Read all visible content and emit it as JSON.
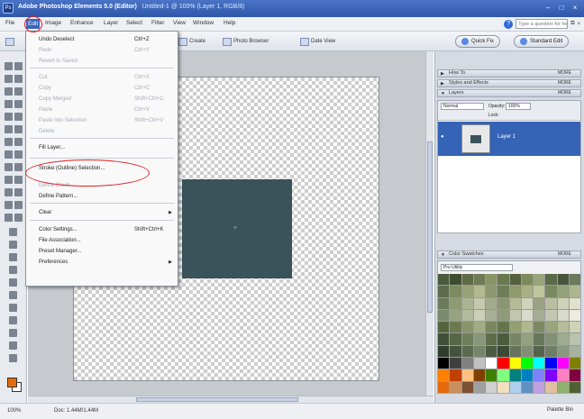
{
  "window": {
    "app_title": "Adobe Photoshop Elements 5.0 (Editor)",
    "doc_title": "Untitled-1 @ 100% (Layer 1, RGB/8)",
    "min": "–",
    "max": "□",
    "close": "×"
  },
  "menubar": {
    "items": [
      "File",
      "Edit",
      "Image",
      "Enhance",
      "Layer",
      "Select",
      "Filter",
      "View",
      "Window",
      "Help"
    ],
    "help_placeholder": "Type a question for help"
  },
  "shortcuts": {
    "create": "Create",
    "photo_browser": "Photo Browser",
    "date_view": "Date View",
    "quick_fix": "Quick Fix",
    "standard_edit": "Standard Edit"
  },
  "edit_menu": {
    "items": [
      {
        "label": "Undo Deselect",
        "shortcut": "Ctrl+Z",
        "enabled": true
      },
      {
        "label": "Redo",
        "shortcut": "Ctrl+Y",
        "enabled": false
      },
      {
        "label": "Revert to Saved",
        "shortcut": "",
        "enabled": false
      },
      {
        "label": "Cut",
        "shortcut": "Ctrl+X",
        "enabled": false
      },
      {
        "label": "Copy",
        "shortcut": "Ctrl+C",
        "enabled": false
      },
      {
        "label": "Copy Merged",
        "shortcut": "Shift+Ctrl+C",
        "enabled": false
      },
      {
        "label": "Paste",
        "shortcut": "Ctrl+V",
        "enabled": false
      },
      {
        "label": "Paste Into Selection",
        "shortcut": "Shift+Ctrl+V",
        "enabled": false
      },
      {
        "label": "Delete",
        "shortcut": "",
        "enabled": false
      },
      {
        "label": "Fill Layer...",
        "shortcut": "",
        "enabled": true
      },
      {
        "label": "Stroke (Outline) Selection...",
        "shortcut": "",
        "enabled": true
      },
      {
        "label": "Define Brush...",
        "shortcut": "",
        "enabled": false
      },
      {
        "label": "Define Pattern...",
        "shortcut": "",
        "enabled": true
      },
      {
        "label": "Clear",
        "shortcut": "",
        "enabled": true
      },
      {
        "label": "Color Settings...",
        "shortcut": "Shift+Ctrl+K",
        "enabled": true
      },
      {
        "label": "File Association...",
        "shortcut": "",
        "enabled": true
      },
      {
        "label": "Preset Manager...",
        "shortcut": "",
        "enabled": true
      },
      {
        "label": "Preferences",
        "shortcut": "",
        "enabled": true
      }
    ]
  },
  "palette_bin": {
    "panels": [
      "How To",
      "Styles and Effects",
      "Layers"
    ],
    "more_label": "MORE",
    "blend_mode": "Normal",
    "opacity_label": "Opacity:",
    "opacity_value": "100%",
    "lock_label": "Lock:",
    "layer_name": "Layer 1",
    "swatches_title": "Color Swatches",
    "swatches_set": "Pro Utility"
  },
  "statusbar": {
    "zoom": "100%",
    "doc_info": "Doc: 1.44M/1.44M",
    "right_label": "Palette Bin"
  },
  "colors": {
    "layer_fill": "#3a525a",
    "foreground": "#e56a0c",
    "background": "#ffffff",
    "annotation": "#e02020"
  },
  "swatch_colors": [
    "#4b5a3a",
    "#3e4d2e",
    "#5f6b45",
    "#6e7b55",
    "#8a9466",
    "#6a7850",
    "#54603e",
    "#7c8a5a",
    "#9aa47a",
    "#5a6a48",
    "#47563a",
    "#6c7a5c",
    "#5e6c4c",
    "#7d8b60",
    "#97a27a",
    "#b2b98f",
    "#8c9670",
    "#6f7d57",
    "#8e9a6c",
    "#a8b084",
    "#c0c59f",
    "#7a8860",
    "#93a07a",
    "#adb690",
    "#6b7a5a",
    "#8d9a72",
    "#aab393",
    "#c5c9ad",
    "#a3ab8a",
    "#8a9674",
    "#b5bb98",
    "#d0d3bb",
    "#9aa283",
    "#b8be9f",
    "#ced2b8",
    "#e0e2d0",
    "#7b8a6c",
    "#98a383",
    "#b4bb9d",
    "#ccd0b9",
    "#a8ae93",
    "#8f9a7b",
    "#c2c6ad",
    "#dadccb",
    "#a6ad93",
    "#c4c8b2",
    "#d9dbcc",
    "#ebecdf",
    "#55643f",
    "#6c7a52",
    "#8a956b",
    "#a3ac84",
    "#7b8760",
    "#66744d",
    "#949f73",
    "#b1b88f",
    "#7d8964",
    "#9aa47d",
    "#b6bd98",
    "#cfd3b6",
    "#3f4f36",
    "#566647",
    "#6f7e5c",
    "#89967a",
    "#5f6d4d",
    "#4c5b3e",
    "#788565",
    "#94a080",
    "#67755a",
    "#829075",
    "#9eab90",
    "#b9c3ad",
    "#2f3d2c",
    "#45533d",
    "#5c6a52",
    "#76846b",
    "#4e5b44",
    "#3c4935",
    "#67745b",
    "#828f75",
    "#56634c",
    "#707d66",
    "#8b9881",
    "#a6b29d",
    "#000000",
    "#404040",
    "#808080",
    "#c0c0c0",
    "#ffffff",
    "#ff0000",
    "#ffff00",
    "#00ff00",
    "#00ffff",
    "#0000ff",
    "#ff00ff",
    "#808000",
    "#ff8000",
    "#c04000",
    "#ffc080",
    "#804000",
    "#408000",
    "#80ff80",
    "#008080",
    "#0080c0",
    "#8080ff",
    "#8000ff",
    "#ff80c0",
    "#800040",
    "#e56a0c",
    "#c89060",
    "#7a5030",
    "#a0a0a0",
    "#d0d0d0",
    "#f0e0c0",
    "#b0d0f0",
    "#6090c0",
    "#c0a0e0",
    "#e0c0a0",
    "#90b070",
    "#506030"
  ]
}
